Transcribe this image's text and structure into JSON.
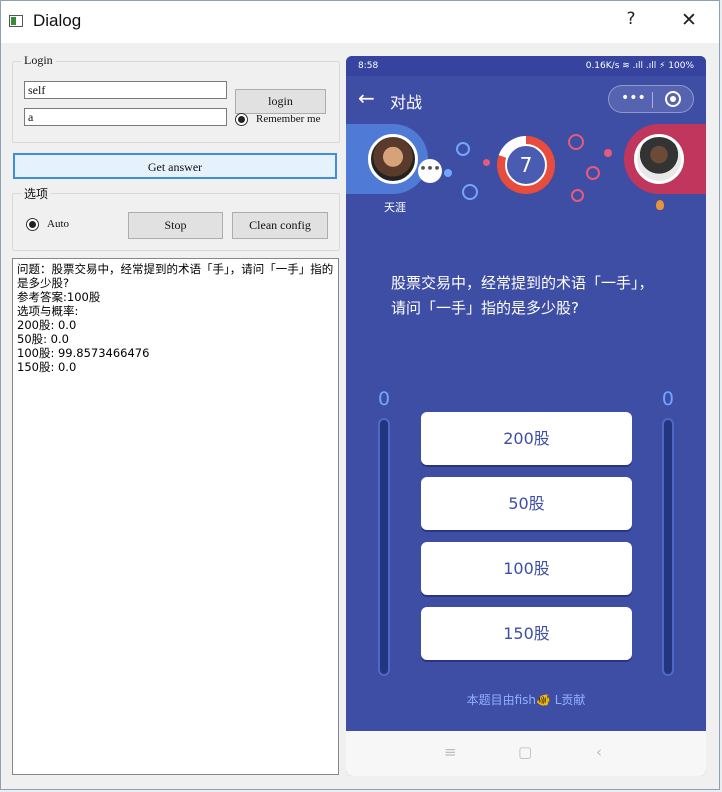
{
  "window": {
    "title": "Dialog",
    "help": "?",
    "close": "✕"
  },
  "login": {
    "group_label": "Login",
    "username": "self",
    "password": "a",
    "login_button": "login",
    "remember_label": "Remember me"
  },
  "get_answer_button": "Get answer",
  "options_group": {
    "label": "选项",
    "auto_label": "Auto",
    "stop_button": "Stop",
    "clean_button": "Clean config"
  },
  "output": {
    "lines": [
      "问题：股票交易中，经常提到的术语「手」，请问「一手」指的是多少股?",
      "参考答案:100股",
      "选项与概率:",
      "200股: 0.0",
      "50股: 0.0",
      "100股: 99.8573466476",
      "150股: 0.0"
    ]
  },
  "phone": {
    "status_time": "8:58",
    "status_right": "0.16K/s  ≋  .ıll  .ıll  ⚡ 100%",
    "nav_title": "对战",
    "capsule_dots": "•••",
    "timer_value": "7",
    "player_left_name": "天涯",
    "question": "股票交易中，经常提到的术语「一手」，请问「一手」指的是多少股?",
    "score_left": "0",
    "score_right": "0",
    "options": [
      "200股",
      "50股",
      "100股",
      "150股"
    ],
    "credit": "本题目由fish🐠 L贡献",
    "sys_nav": {
      "menu": "≡",
      "home": "▢",
      "back": "‹"
    }
  },
  "colors": {
    "phone_bg": "#3f4ea5",
    "left_player": "#4f7bd6",
    "right_player": "#c0365c",
    "timer": "#e74c3c",
    "score": "#6fa7ff"
  }
}
